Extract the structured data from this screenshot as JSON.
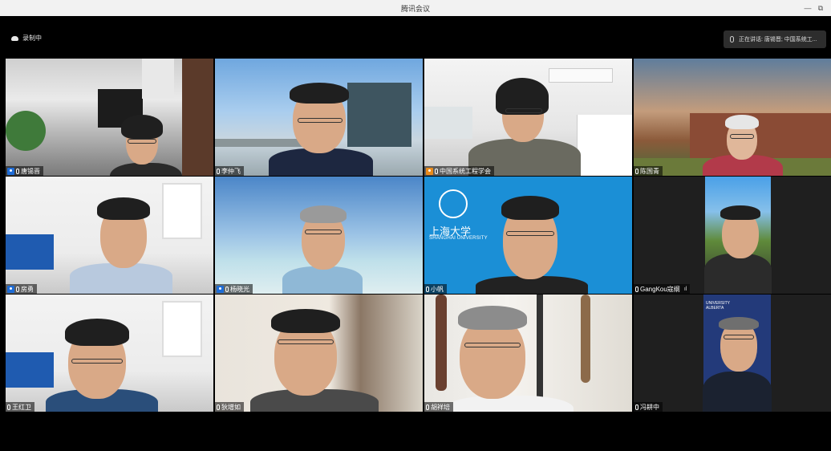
{
  "window": {
    "title": "腾讯会议",
    "minimize_icon": "minimize-icon",
    "restore_icon": "restore-icon"
  },
  "recording": {
    "label": "录制中",
    "icon": "cloud-icon"
  },
  "speaking": {
    "text": "正在讲话: 唐锡晋; 中国系统工..."
  },
  "participants": [
    {
      "name": "唐锡晋",
      "role": "host"
    },
    {
      "name": "李仲飞",
      "role": ""
    },
    {
      "name": "中国系统工程学会",
      "role": "cohost"
    },
    {
      "name": "陈国青",
      "role": ""
    },
    {
      "name": "房勇",
      "role": "host"
    },
    {
      "name": "杨晓光",
      "role": "host"
    },
    {
      "name": "小帆",
      "role": ""
    },
    {
      "name": "GangKou寇纲",
      "role": "",
      "signal": "ıl"
    },
    {
      "name": "王红卫",
      "role": ""
    },
    {
      "name": "狄增如",
      "role": ""
    },
    {
      "name": "胡祥培",
      "role": ""
    },
    {
      "name": "冯耕中",
      "role": ""
    }
  ],
  "backgrounds": {
    "shanghai_cn": "上海大学",
    "shanghai_en": "SHANGHAI UNIVERSITY",
    "alberta": "UNIVERSITY\nALBERTA"
  },
  "colors": {
    "active_speaker_border": "#6bd36b",
    "host_badge": "#1e6cd6",
    "cohost_badge": "#e88a1a"
  }
}
